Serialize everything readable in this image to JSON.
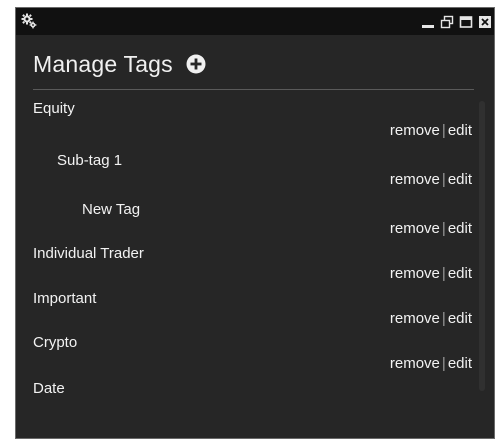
{
  "window": {
    "controls": [
      "minimize-icon",
      "restore-icon",
      "maximize-icon",
      "close-icon"
    ]
  },
  "header": {
    "title": "Manage Tags",
    "add_icon": "plus-circle-icon"
  },
  "actions": {
    "remove_label": "remove",
    "separator": "|",
    "edit_label": "edit"
  },
  "tags": [
    {
      "name": "Equity",
      "level": 0
    },
    {
      "name": "Sub-tag 1",
      "level": 1
    },
    {
      "name": "New Tag",
      "level": 2
    },
    {
      "name": "Individual Trader",
      "level": 0
    },
    {
      "name": "Important",
      "level": 0
    },
    {
      "name": "Crypto",
      "level": 0
    },
    {
      "name": "Date",
      "level": 0
    }
  ],
  "colors": {
    "window_bg": "#262626",
    "titlebar_bg": "#111111",
    "text": "#f2f2f2"
  }
}
